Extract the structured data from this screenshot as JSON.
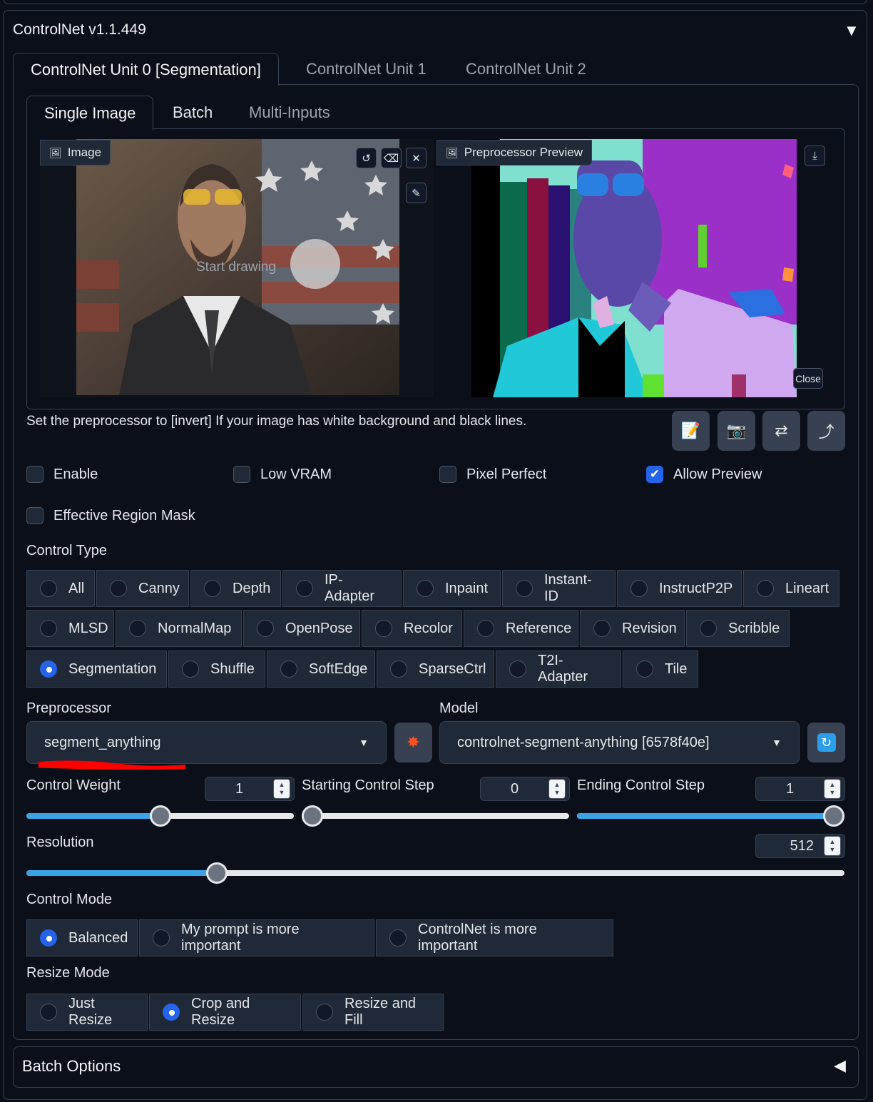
{
  "panel": {
    "title": "ControlNet v1.1.449",
    "collapse_icon": "▼"
  },
  "unit_tabs": [
    "ControlNet Unit 0 [Segmentation]",
    "ControlNet Unit 1",
    "ControlNet Unit 2"
  ],
  "input_tabs": [
    "Single Image",
    "Batch",
    "Multi-Inputs"
  ],
  "image_panel": {
    "label": "Image",
    "placeholder": "Start drawing"
  },
  "preview_panel": {
    "label": "Preprocessor Preview",
    "close_label": "Close"
  },
  "hint": "Set the preprocessor to [invert] If your image has white background and black lines.",
  "checkboxes": [
    {
      "label": "Enable",
      "checked": false
    },
    {
      "label": "Low VRAM",
      "checked": false
    },
    {
      "label": "Pixel Perfect",
      "checked": false
    },
    {
      "label": "Allow Preview",
      "checked": true
    },
    {
      "label": "Effective Region Mask",
      "checked": false
    }
  ],
  "control_type": {
    "label": "Control Type",
    "rows": [
      [
        "All",
        "Canny",
        "Depth",
        "IP-Adapter",
        "Inpaint",
        "Instant-ID",
        "InstructP2P",
        "Lineart"
      ],
      [
        "MLSD",
        "NormalMap",
        "OpenPose",
        "Recolor",
        "Reference",
        "Revision",
        "Scribble"
      ],
      [
        "Segmentation",
        "Shuffle",
        "SoftEdge",
        "SparseCtrl",
        "T2I-Adapter",
        "Tile"
      ]
    ],
    "selected": "Segmentation"
  },
  "preprocessor": {
    "label": "Preprocessor",
    "value": "segment_anything"
  },
  "model": {
    "label": "Model",
    "value": "controlnet-segment-anything [6578f40e]"
  },
  "sliders": {
    "control_weight": {
      "label": "Control Weight",
      "value": "1",
      "fraction": 0.5
    },
    "starting_step": {
      "label": "Starting Control Step",
      "value": "0",
      "fraction": 0.0
    },
    "ending_step": {
      "label": "Ending Control Step",
      "value": "1",
      "fraction": 1.0
    },
    "resolution": {
      "label": "Resolution",
      "value": "512",
      "fraction": 0.233
    }
  },
  "control_mode": {
    "label": "Control Mode",
    "options": [
      "Balanced",
      "My prompt is more important",
      "ControlNet is more important"
    ],
    "selected": "Balanced"
  },
  "resize_mode": {
    "label": "Resize Mode",
    "options": [
      "Just Resize",
      "Crop and Resize",
      "Resize and Fill"
    ],
    "selected": "Crop and Resize"
  },
  "batch_options": {
    "label": "Batch Options",
    "expand_icon": "◀"
  },
  "colors": {
    "accent": "#2563eb",
    "slider_fill": "#3ba3e5",
    "annotation_red": "#ff0000"
  }
}
